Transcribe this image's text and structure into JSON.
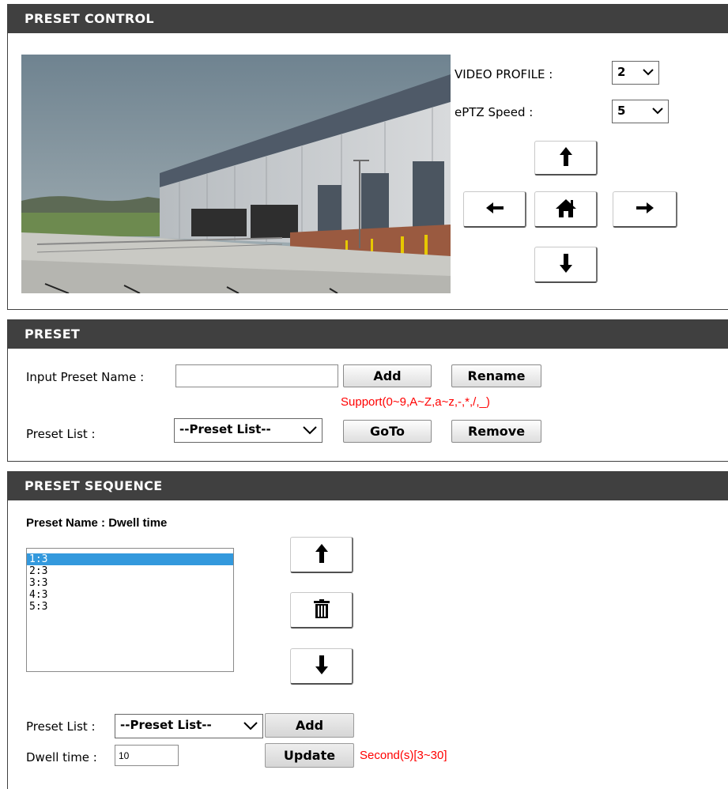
{
  "preset_control": {
    "title": "PRESET CONTROL",
    "video_profile_label": "VIDEO PROFILE :",
    "video_profile_value": "2",
    "eptz_speed_label": "ePTZ Speed :",
    "eptz_speed_value": "5",
    "icons": [
      "arrow-up-icon",
      "arrow-left-icon",
      "home-icon",
      "arrow-right-icon",
      "arrow-down-icon"
    ]
  },
  "preset": {
    "title": "PRESET",
    "input_label": "Input Preset Name :",
    "input_value": "",
    "add_label": "Add",
    "rename_label": "Rename",
    "support_text": "Support(0~9,A~Z,a~z,-,*,/,_)",
    "list_label": "Preset List :",
    "list_value": "--Preset List--",
    "goto_label": "GoTo",
    "remove_label": "Remove"
  },
  "preset_sequence": {
    "title": "PRESET SEQUENCE",
    "header": "Preset Name : Dwell time",
    "items": [
      "1:3",
      "2:3",
      "3:3",
      "4:3",
      "5:3"
    ],
    "selected_index": 0,
    "list_label": "Preset List :",
    "list_value": "--Preset List--",
    "add_label": "Add",
    "dwell_label": "Dwell time :",
    "dwell_value": "10",
    "update_label": "Update",
    "dwell_hint": "Second(s)[3~30]",
    "icons": [
      "arrow-up-icon",
      "trash-icon",
      "arrow-down-icon"
    ]
  },
  "colors": {
    "header_bg": "#404040",
    "hint_red": "#ff0000",
    "selection_blue": "#3399dd"
  }
}
